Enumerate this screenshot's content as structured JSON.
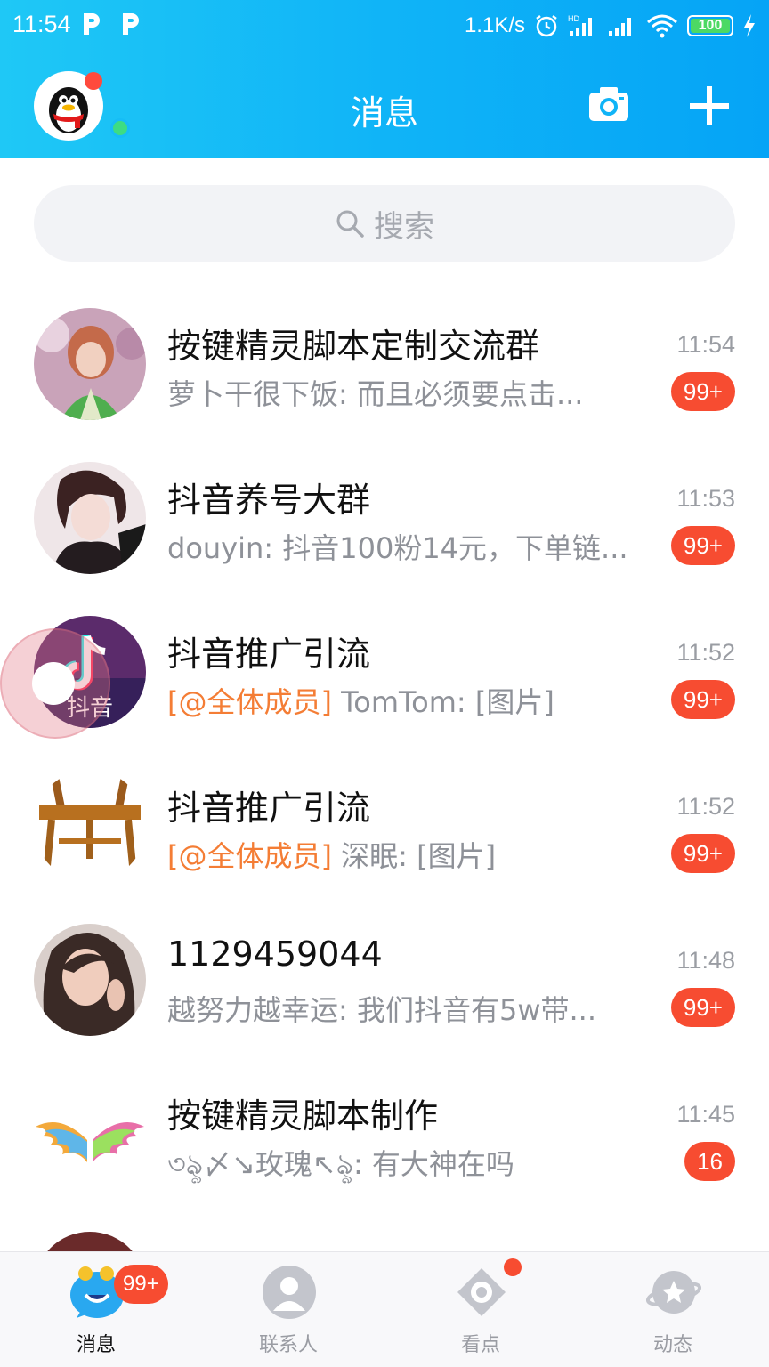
{
  "status_bar": {
    "time": "11:54",
    "net_speed": "1.1K/s",
    "battery": "100",
    "icons": [
      "p-icon",
      "p-icon",
      "alarm-icon",
      "hd-signal-icon",
      "signal-icon",
      "wifi-icon",
      "battery-icon",
      "charging-icon"
    ]
  },
  "header": {
    "title": "消息",
    "camera_icon": "camera-icon",
    "plus_icon": "plus-icon"
  },
  "search": {
    "placeholder": "搜索"
  },
  "conversations": [
    {
      "name": "按键精灵脚本定制交流群",
      "mention": "",
      "preview": "萝卜干很下饭: 而且必须要点击...",
      "time": "11:54",
      "badge": "99+"
    },
    {
      "name": "抖音养号大群",
      "mention": "",
      "preview": "douyin: 抖音100粉14元，下单链...",
      "time": "11:53",
      "badge": "99+"
    },
    {
      "name": "抖音推广引流",
      "mention": "[@全体成员]",
      "preview": " TomTom: [图片]",
      "time": "11:52",
      "badge": "99+"
    },
    {
      "name": "抖音推广引流",
      "mention": "[@全体成员]",
      "preview": " 深眠: [图片]",
      "time": "11:52",
      "badge": "99+"
    },
    {
      "name": "1129459044",
      "mention": "",
      "preview": "越努力越幸运: 我们抖音有5w带...",
      "time": "11:48",
      "badge": "99+"
    },
    {
      "name": "按键精灵脚本制作",
      "mention": "",
      "preview": "৩ৡ〆↘玫瑰↖ৡ: 有大神在吗",
      "time": "11:45",
      "badge": "16"
    }
  ],
  "tabs": [
    {
      "label": "消息",
      "icon": "message-icon",
      "badge": "99+"
    },
    {
      "label": "联系人",
      "icon": "contact-icon"
    },
    {
      "label": "看点",
      "icon": "eye-icon"
    },
    {
      "label": "动态",
      "icon": "planet-icon"
    }
  ],
  "colors": {
    "header_start": "#1fc8f6",
    "header_end": "#05a4f6",
    "badge": "#f74c31",
    "mention": "#f47d35"
  }
}
